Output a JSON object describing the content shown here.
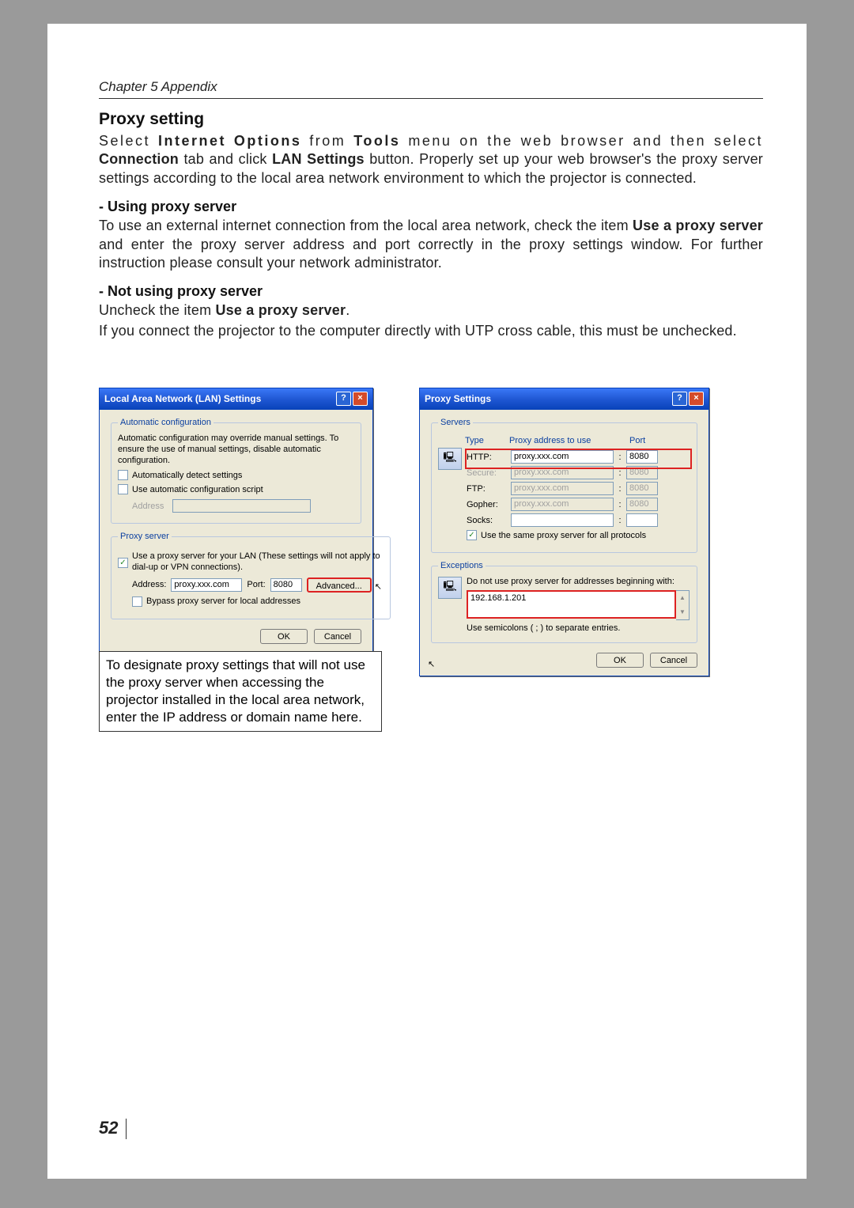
{
  "chapter": "Chapter 5 Appendix",
  "sectionTitle": "Proxy setting",
  "intro_p1_a": "Select ",
  "intro_p1_b": "Internet Options",
  "intro_p1_c": " from ",
  "intro_p1_d": "Tools",
  "intro_p1_e": " menu on the web browser and then select ",
  "intro_p1_f": "Connection",
  "intro_p1_g": " tab and click ",
  "intro_p1_h": "LAN Settings",
  "intro_p1_i": " button. Properly set up your web browser's the proxy server settings according to the local area network environment to which the projector is connected.",
  "sub1_title": "- Using proxy server",
  "sub1_p_a": "To use an external internet connection from the local area network, check the item ",
  "sub1_p_b": "Use a proxy server",
  "sub1_p_c": " and enter the proxy server address and port correctly in the proxy settings window. For further instruction please consult your network administrator.",
  "sub2_title": "- Not using proxy server",
  "sub2_p1_a": "Uncheck the item ",
  "sub2_p1_b": "Use a proxy server",
  "sub2_p1_c": ".",
  "sub2_p2": "If you connect the projector to the computer directly with UTP cross cable, this must be unchecked.",
  "caption": "To designate proxy settings that will not use the proxy server when accessing the projector installed in the local area network, enter the IP address or domain name here.",
  "pageNumber": "52",
  "lanDialog": {
    "title": "Local Area Network (LAN) Settings",
    "autoLegend": "Automatic configuration",
    "autoText": "Automatic configuration may override manual settings.  To ensure the use of manual settings, disable automatic configuration.",
    "autoCheck1": "Automatically detect settings",
    "autoCheck2": "Use automatic configuration script",
    "addrLabel": "Address",
    "proxyLegend": "Proxy server",
    "proxyCheckText": "Use a proxy server for your LAN (These settings will not apply to dial-up or VPN connections).",
    "addressLabel": "Address:",
    "addressVal": "proxy.xxx.com",
    "portLabel": "Port:",
    "portVal": "8080",
    "advancedBtn": "Advanced...",
    "bypassCheck": "Bypass proxy server for local addresses",
    "okBtn": "OK",
    "cancelBtn": "Cancel"
  },
  "proxyDialog": {
    "title": "Proxy Settings",
    "serversLegend": "Servers",
    "headerType": "Type",
    "headerAddr": "Proxy address to use",
    "headerPort": "Port",
    "rows": {
      "http": {
        "label": "HTTP:",
        "addr": "proxy.xxx.com",
        "port": "8080",
        "enabled": true
      },
      "secure": {
        "label": "Secure:",
        "addr": "proxy.xxx.com",
        "port": "8080",
        "enabled": false
      },
      "ftp": {
        "label": "FTP:",
        "addr": "proxy.xxx.com",
        "port": "8080",
        "enabled": false
      },
      "gopher": {
        "label": "Gopher:",
        "addr": "proxy.xxx.com",
        "port": "8080",
        "enabled": false
      },
      "socks": {
        "label": "Socks:",
        "addr": "",
        "port": "",
        "enabled": true
      }
    },
    "sameCheck": "Use the same proxy server for all protocols",
    "excLegend": "Exceptions",
    "excText": "Do not use proxy server for addresses beginning with:",
    "excValue": "192.168.1.201",
    "excNote": "Use semicolons ( ; ) to separate entries.",
    "okBtn": "OK",
    "cancelBtn": "Cancel"
  }
}
